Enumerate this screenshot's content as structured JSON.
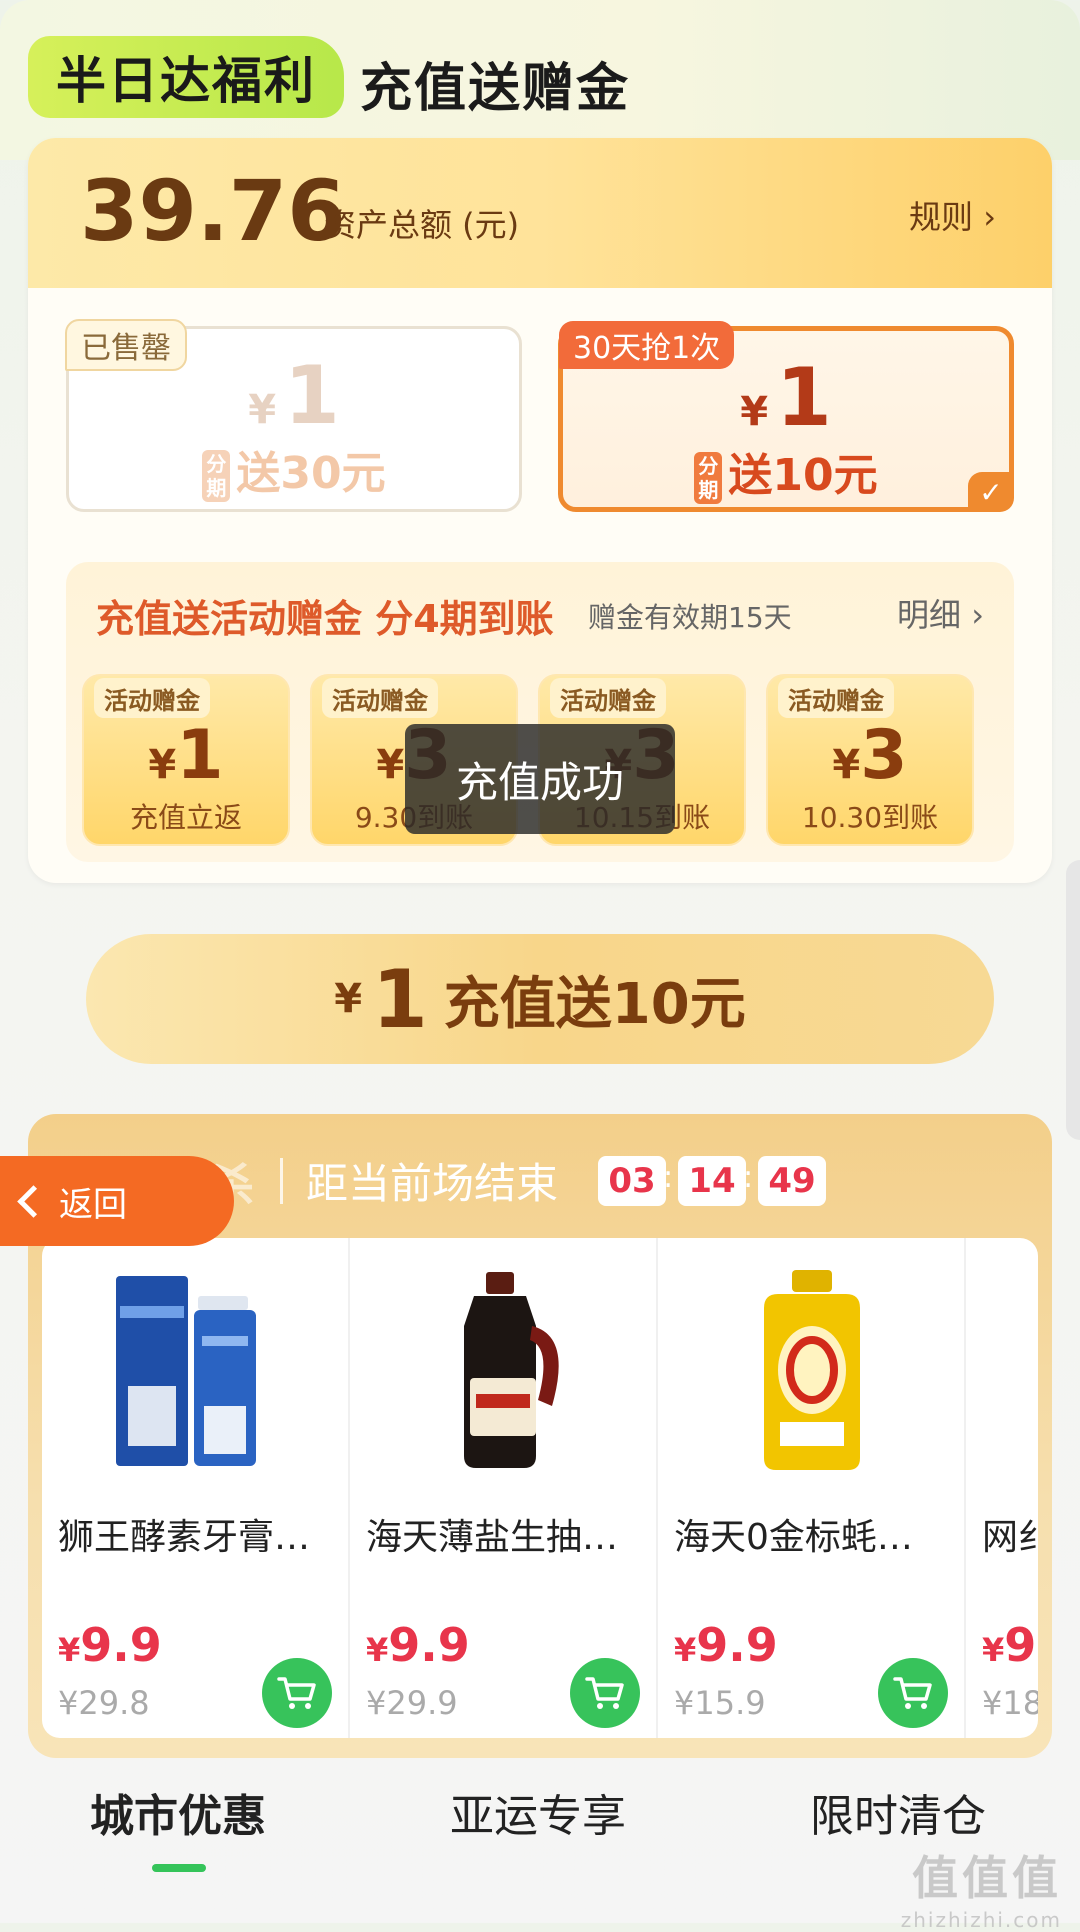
{
  "header": {
    "tag": "半日达福利",
    "title": "充值送赠金"
  },
  "balance": {
    "amount": "39.76",
    "label": "资产总额 (元)",
    "rules": "规则 ›"
  },
  "options": [
    {
      "badge": "已售罄",
      "yen": "¥",
      "amount": "1",
      "installment": "分期",
      "gift": "送30元",
      "state": "sold-out"
    },
    {
      "badge": "30天抢1次",
      "yen": "¥",
      "amount": "1",
      "installment": "分期",
      "gift": "送10元",
      "state": "selected",
      "check": "✓"
    }
  ],
  "detail": {
    "title": "充值送活动赠金 分4期到账",
    "validity": "赠金有效期15天",
    "detail_link": "明细 ›",
    "items": [
      {
        "label": "活动赠金",
        "yen": "¥",
        "amount": "1",
        "note": "充值立返"
      },
      {
        "label": "活动赠金",
        "yen": "¥",
        "amount": "3",
        "note": "9.30到账"
      },
      {
        "label": "活动赠金",
        "yen": "¥",
        "amount": "3",
        "note": "10.15到账"
      },
      {
        "label": "活动赠金",
        "yen": "¥",
        "amount": "3",
        "note": "10.30到账"
      }
    ]
  },
  "toast": "充值成功",
  "cta": {
    "yen": "¥",
    "amount": "1",
    "text": "充值送10元"
  },
  "flash_sale": {
    "title": "城市秒杀",
    "subtitle": "距当前场结束",
    "countdown": {
      "h": "03",
      "m": "14",
      "s": "49"
    },
    "products": [
      {
        "name": "狮王酵素牙膏…",
        "yen": "¥",
        "price": "9.9",
        "original": "¥29.8",
        "icon": "toothpaste-icon"
      },
      {
        "name": "海天薄盐生抽…",
        "yen": "¥",
        "price": "9.9",
        "original": "¥29.9",
        "icon": "soy-sauce-icon"
      },
      {
        "name": "海天0金标蚝…",
        "yen": "¥",
        "price": "9.9",
        "original": "¥15.9",
        "icon": "oyster-sauce-icon"
      },
      {
        "name": "网纟",
        "yen": "¥",
        "price": "9",
        "original": "¥18",
        "icon": "product-icon"
      }
    ]
  },
  "back_button": "返回",
  "tabs": [
    {
      "label": "城市优惠",
      "active": true
    },
    {
      "label": "亚运专享",
      "active": false
    },
    {
      "label": "限时清仓",
      "active": false
    }
  ],
  "watermark": {
    "logo": "值值值",
    "url": "zhizhizhi.com"
  },
  "colors": {
    "accent_orange": "#ef8a2f",
    "price_red": "#e8354b",
    "cart_green": "#37c35b",
    "tag_green": "#c6ec52"
  }
}
